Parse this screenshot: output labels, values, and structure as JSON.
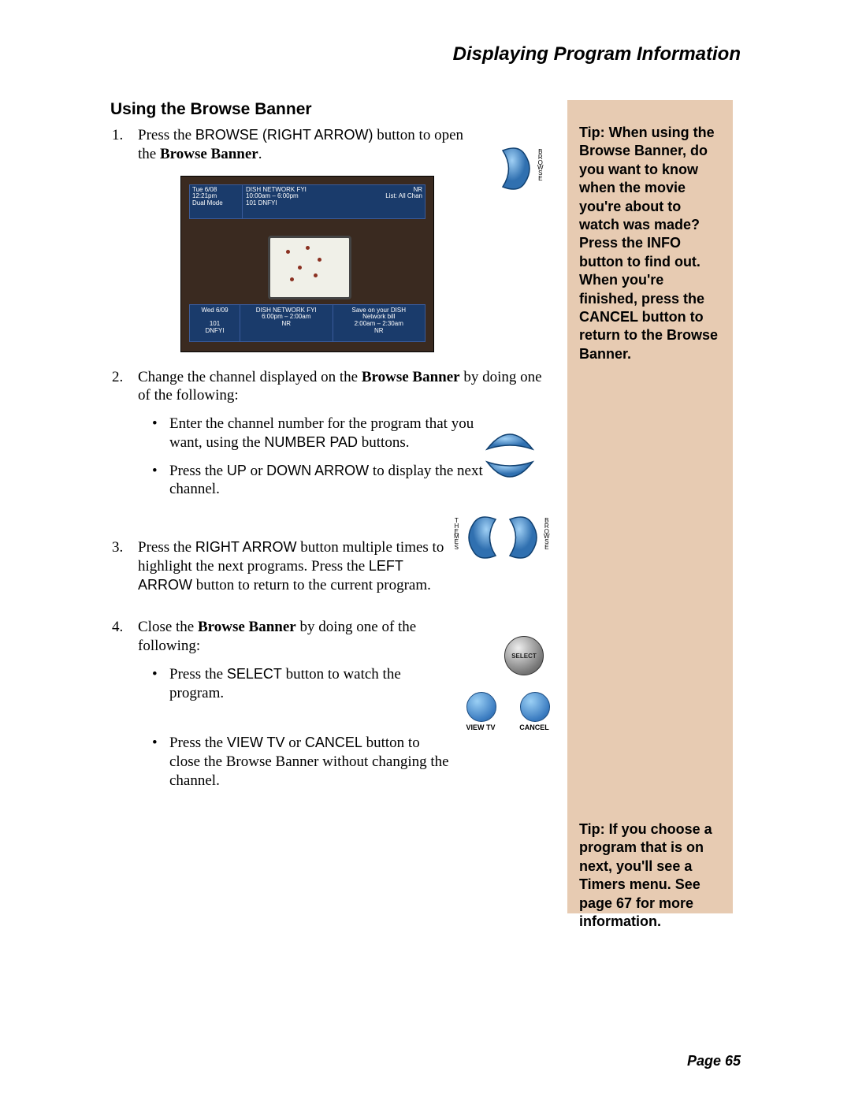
{
  "header": "Displaying Program Information",
  "section_title": "Using the Browse Banner",
  "steps": {
    "s1_pre": "Press the ",
    "s1_btn": "BROWSE (RIGHT ARROW)",
    "s1_mid": " button to open the ",
    "s1_bold": "Browse Banner",
    "s1_post": ".",
    "s2_pre": "Change the channel displayed on the ",
    "s2_bold": "Browse Banner",
    "s2_post": " by doing one of the following:",
    "s2b1_a": "Enter the channel number for the program that you want, using the ",
    "s2b1_b": "NUMBER PAD",
    "s2b1_c": " buttons.",
    "s2b2_a": "Press the ",
    "s2b2_b": "UP",
    "s2b2_c": " or ",
    "s2b2_d": "DOWN ARROW",
    "s2b2_e": " to display the next channel.",
    "s3_a": "Press the ",
    "s3_b": "RIGHT ARROW",
    "s3_c": " button multiple times to highlight the next programs. Press the ",
    "s3_d": "LEFT ARROW",
    "s3_e": " button to return to the current program.",
    "s4_a": "Close the ",
    "s4_b": "Browse Banner",
    "s4_c": " by doing one of the following:",
    "s4b1_a": "Press the ",
    "s4b1_b": "SELECT",
    "s4b1_c": " button to watch the program.",
    "s4b2_a": "Press the ",
    "s4b2_b": "VIEW TV",
    "s4b2_c": " or ",
    "s4b2_d": "CANCEL",
    "s4b2_e": " button to close the Browse Banner without changing the channel."
  },
  "nums": {
    "n1": "1.",
    "n2": "2.",
    "n3": "3.",
    "n4": "4."
  },
  "tips": {
    "t1": "Tip: When using the Browse Banner, do you want to know when the movie you're about to watch was made? Press the INFO button to find out. When you're finished, press the CANCEL button to return to the Browse Banner.",
    "t2": "Tip: If you choose a program that is on next, you'll see a Timers menu. See page 67 for more information."
  },
  "screenshot": {
    "top_left": {
      "l1": "Tue 6/08",
      "l2": "12:21pm",
      "l3": "Dual Mode"
    },
    "top_mid": {
      "l1": "DISH NETWORK FYI",
      "l2": "10:00am – 6:00pm",
      "l3": "101   DNFYI"
    },
    "top_right": {
      "l1": "NR",
      "l2": "List: All Chan"
    },
    "bot_left": {
      "l1": "Wed 6/09",
      "l3": "101",
      "l4": "DNFYI"
    },
    "bot_mid": {
      "l1": "DISH NETWORK FYI",
      "l2": "6:00pm – 2:00am",
      "l3": "NR"
    },
    "bot_right": {
      "l1": "Save on your DISH",
      "l2": "Network bill",
      "l3": "2:00am – 2:30am",
      "l4": "NR"
    }
  },
  "labels": {
    "browse_v": "B\nR\nO\nW\nS\nE",
    "themes_v": "T\nH\nE\nM\nE\nS",
    "select": "SELECT",
    "viewtv": "VIEW TV",
    "cancel": "CANCEL"
  },
  "page_num": "Page 65"
}
